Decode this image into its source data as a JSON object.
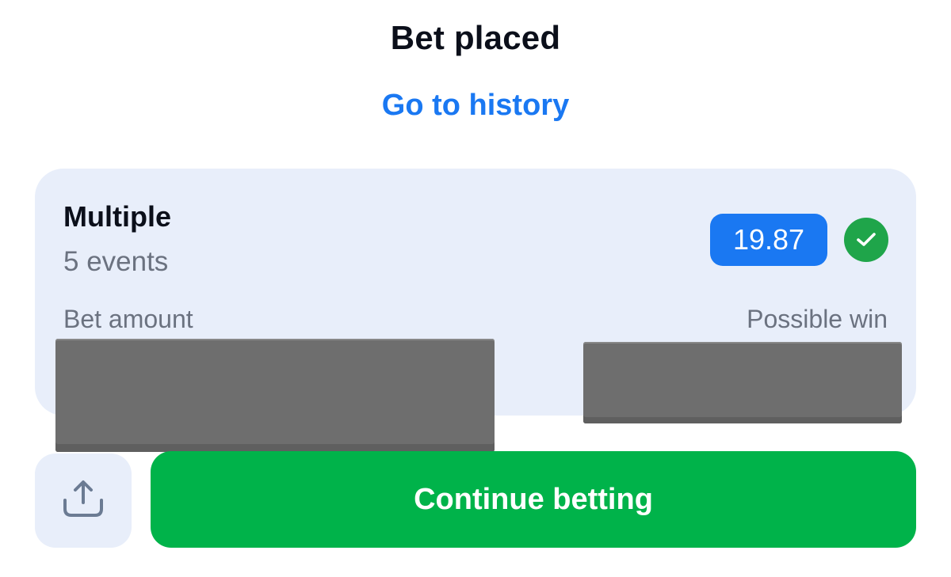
{
  "header": {
    "title": "Bet placed",
    "history_link": "Go to history"
  },
  "bet_card": {
    "bet_type": "Multiple",
    "events_count": "5 events",
    "odds": "19.87",
    "status": "placed",
    "bet_amount_label": "Bet amount",
    "possible_win_label": "Possible win"
  },
  "actions": {
    "share_icon": "share-icon",
    "continue_label": "Continue betting"
  },
  "colors": {
    "accent_blue": "#1a78f2",
    "success_green": "#00b34a",
    "card_background": "#e8eefa",
    "redaction_gray": "#6e6e6e"
  }
}
